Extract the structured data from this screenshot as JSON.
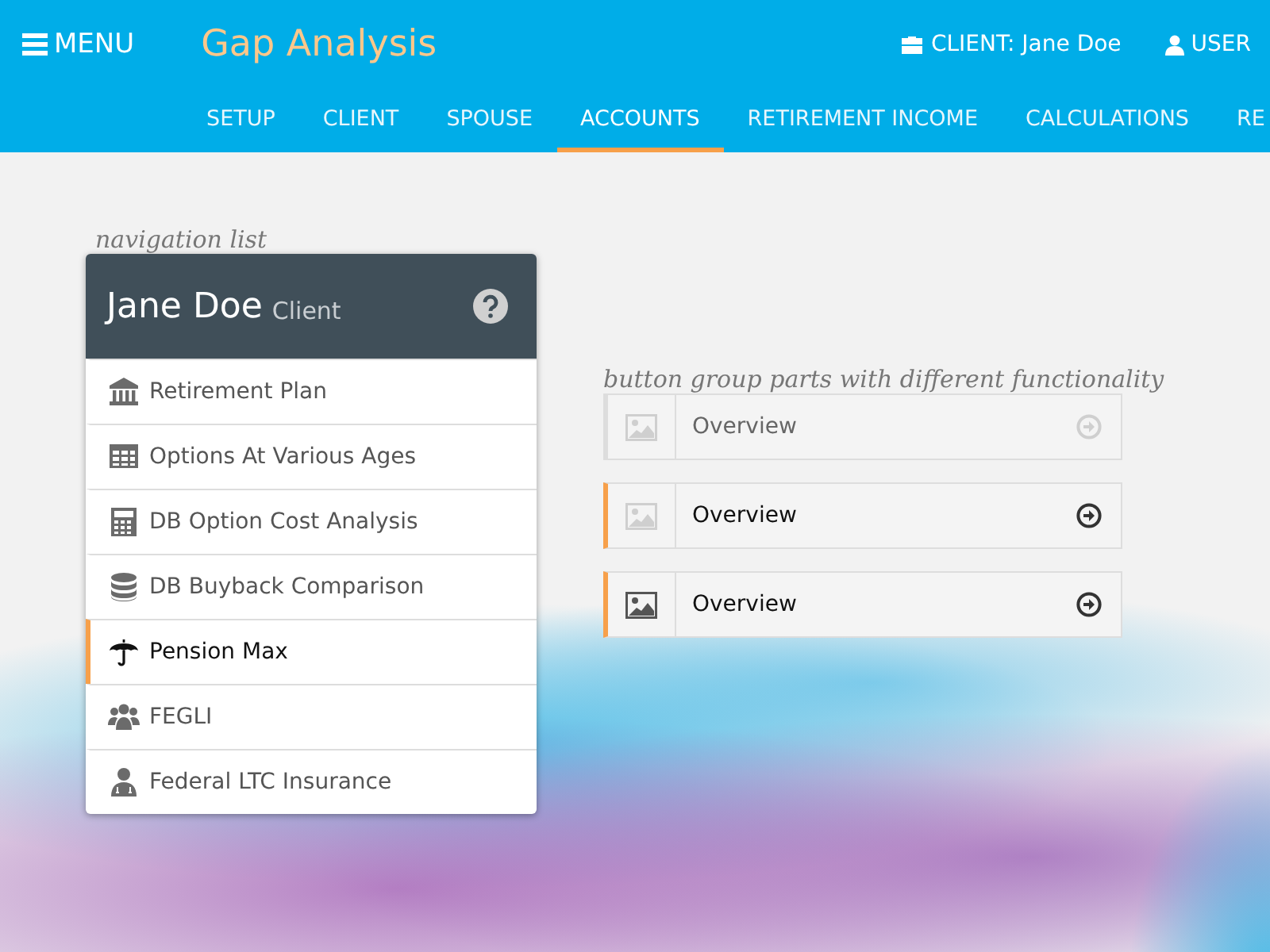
{
  "header": {
    "menu_label": "MENU",
    "app_title": "Gap Analysis",
    "client_label": "CLIENT: Jane Doe",
    "user_label": "USER"
  },
  "tabs": [
    {
      "label": "SETUP",
      "selected": false
    },
    {
      "label": "CLIENT",
      "selected": false
    },
    {
      "label": "SPOUSE",
      "selected": false
    },
    {
      "label": "ACCOUNTS",
      "selected": true
    },
    {
      "label": "RETIREMENT INCOME",
      "selected": false
    },
    {
      "label": "CALCULATIONS",
      "selected": false
    },
    {
      "label": "RE",
      "selected": false
    }
  ],
  "nav_caption": "navigation list",
  "nav_card": {
    "name": "Jane Doe",
    "role": "Client"
  },
  "nav_items": [
    {
      "label": "Retirement Plan",
      "selected": false
    },
    {
      "label": "Options At Various Ages",
      "selected": false
    },
    {
      "label": "DB Option Cost Analysis",
      "selected": false
    },
    {
      "label": "DB Buyback Comparison",
      "selected": false
    },
    {
      "label": "Pension Max",
      "selected": true
    },
    {
      "label": "FEGLI",
      "selected": false
    },
    {
      "label": "Federal LTC Insurance",
      "selected": false
    }
  ],
  "button_caption": "button group parts with different functionality",
  "button_group": [
    {
      "label": "Overview",
      "selected": false,
      "image_active": false,
      "arrow_active": false
    },
    {
      "label": "Overview",
      "selected": true,
      "image_active": false,
      "arrow_active": true
    },
    {
      "label": "Overview",
      "selected": true,
      "image_active": true,
      "arrow_active": true
    }
  ]
}
